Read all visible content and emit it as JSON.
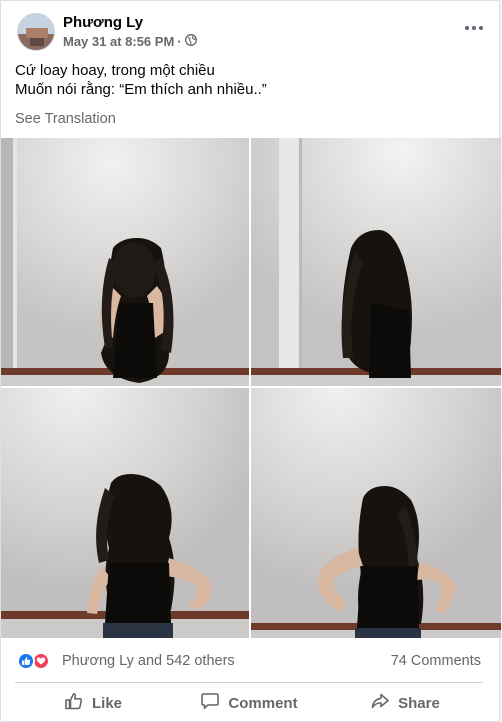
{
  "post": {
    "author": "Phương Ly",
    "timestamp": "May 31 at 8:56 PM",
    "separator": "·",
    "privacy_icon": "globe-icon",
    "text_line1": "Cứ loay hoay, trong một chiều",
    "text_line2": "Muốn nói rằng: “Em thích anh nhiều..”",
    "see_translation": "See Translation"
  },
  "photos": [
    {
      "name": "photo-1"
    },
    {
      "name": "photo-2"
    },
    {
      "name": "photo-3"
    },
    {
      "name": "photo-4"
    }
  ],
  "reactions": {
    "icons": [
      "like-icon",
      "love-icon"
    ],
    "summary": "Phương Ly and 542 others",
    "comments": "74 Comments"
  },
  "actions": {
    "like": "Like",
    "comment": "Comment",
    "share": "Share"
  },
  "colors": {
    "like_blue": "#1877f2",
    "love_red": "#f33e58",
    "secondary_text": "#65676b"
  }
}
